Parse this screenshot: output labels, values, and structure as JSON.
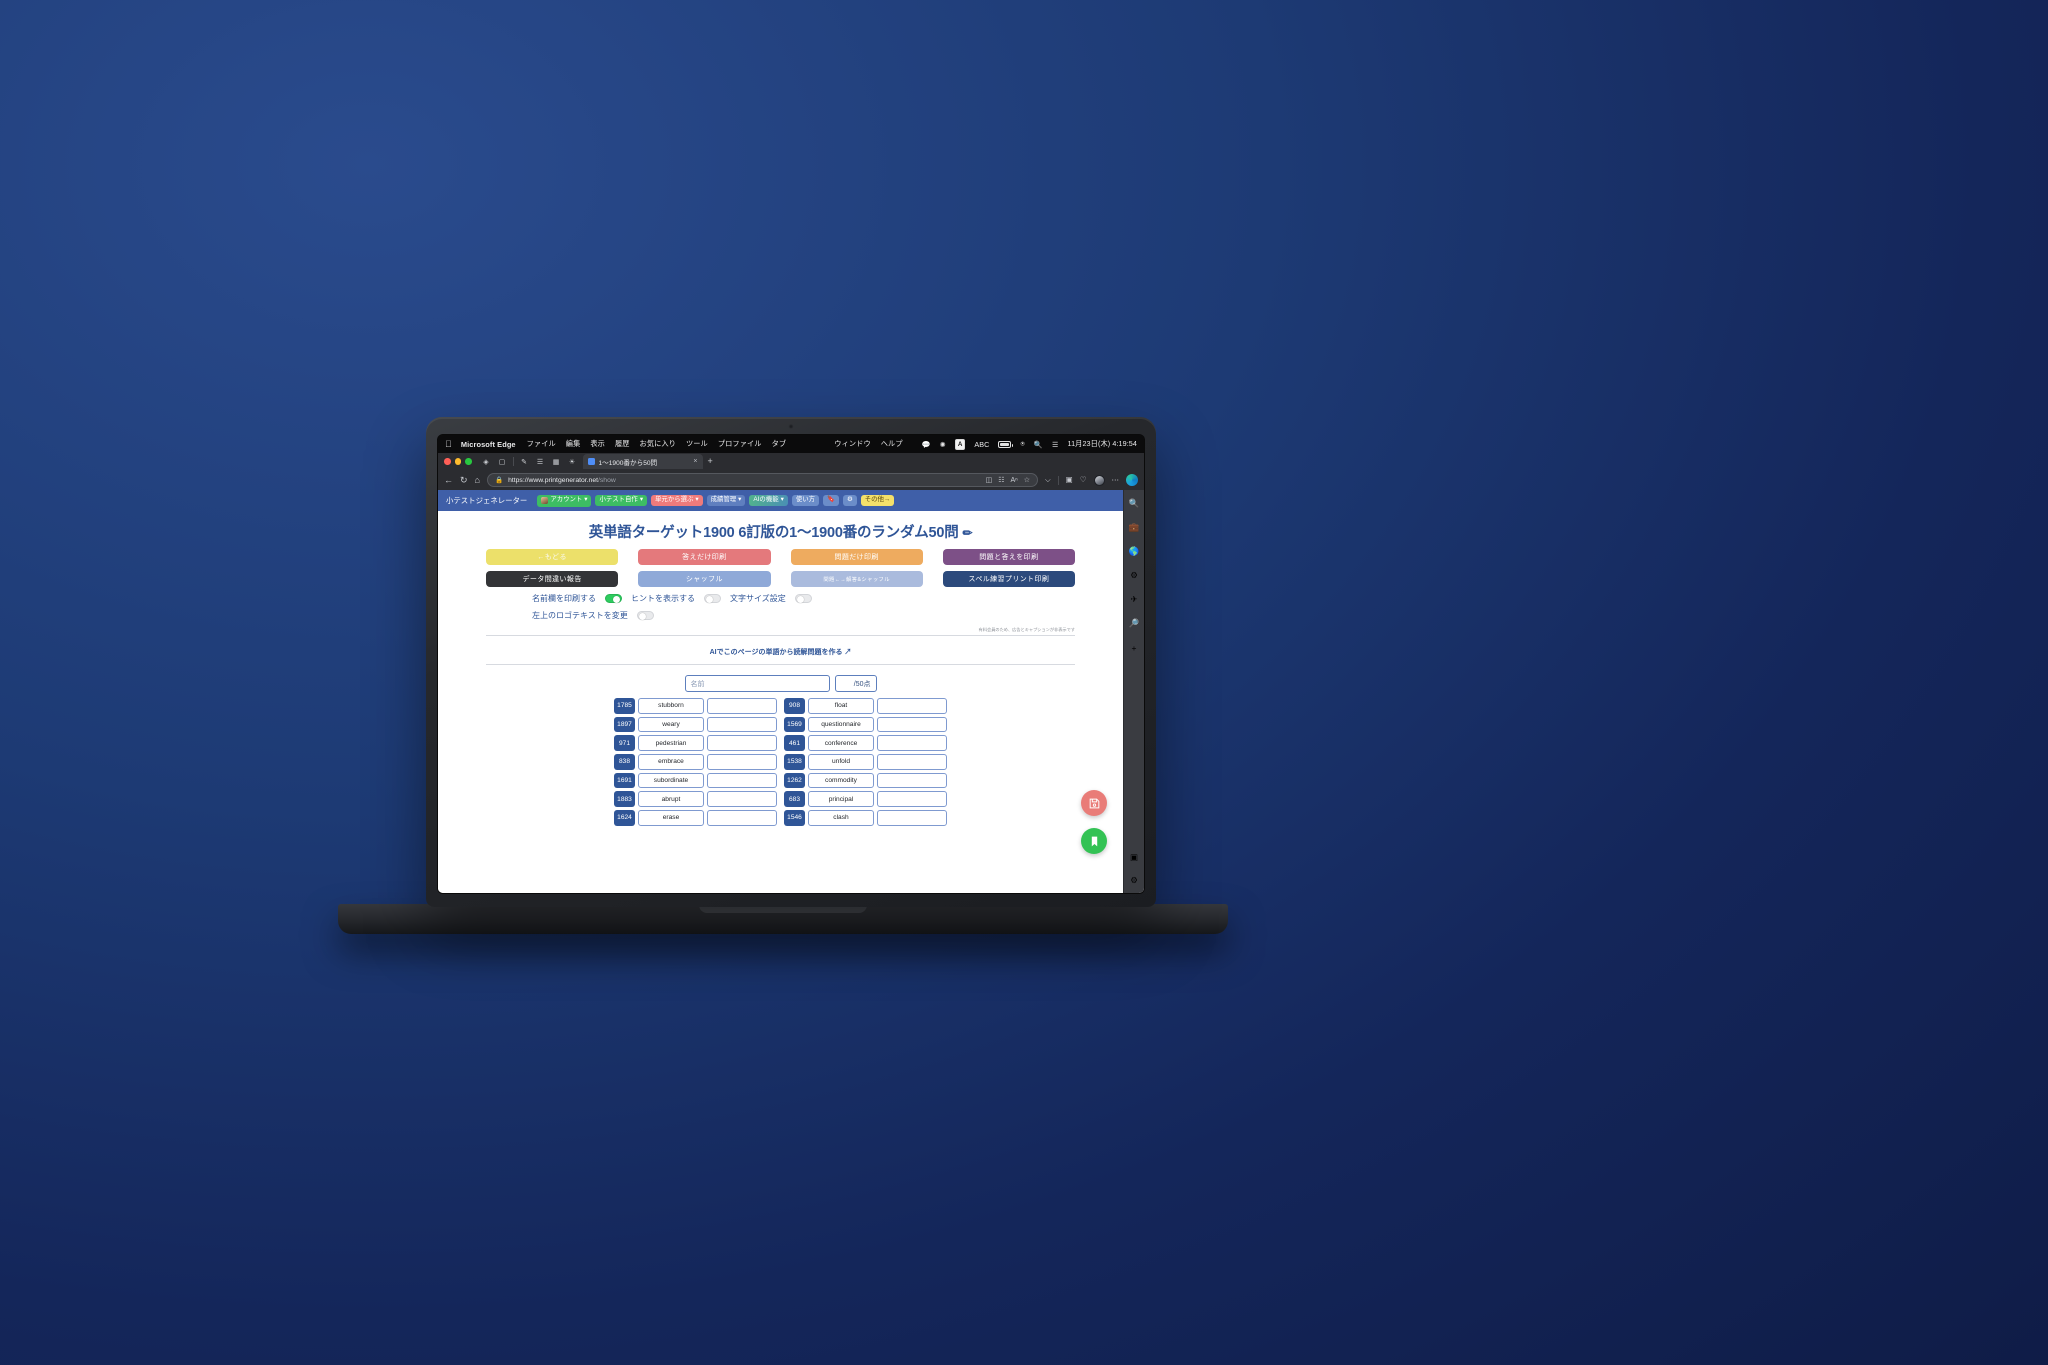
{
  "desktop": {
    "wallpaper_color": "#1d3a74"
  },
  "macos_menubar": {
    "apple_icon": "apple-icon",
    "app_name": "Microsoft Edge",
    "menus": [
      "ファイル",
      "編集",
      "表示",
      "履歴",
      "お気に入り",
      "ツール",
      "プロファイル",
      "タブ"
    ],
    "right_menus": [
      "ウィンドウ",
      "ヘルプ"
    ],
    "status_icons": [
      "chat-icon",
      "bluetooth-icon",
      "input-source-badge",
      "battery-icon",
      "wifi-icon",
      "search-icon",
      "control-center-icon"
    ],
    "input_source_label": "A",
    "input_source_text": "ABC",
    "datetime": "11月23日(木) 4:19:54"
  },
  "browser": {
    "tab": {
      "title": "1〜1900番から50問",
      "close_label": "×"
    },
    "new_tab_label": "+",
    "back_icon": "back-arrow-icon",
    "reload_icon": "reload-icon",
    "home_icon": "home-icon",
    "lock_icon": "lock-icon",
    "url_domain": "https://www.printgenerator.net",
    "url_path": "/show",
    "omnibox_icons": [
      "split-screen-icon",
      "qr-code-icon",
      "read-aloud-icon",
      "favorite-star-icon"
    ],
    "toolbar_icons": [
      "history-icon",
      "split-screen-icon",
      "collections-icon",
      "profile-avatar-icon",
      "more-options-icon",
      "copilot-icon"
    ],
    "sidebar_icons": [
      "search-icon",
      "tools-icon",
      "browser-essentials-icon",
      "settings-app-icon",
      "send-icon",
      "discover-icon",
      "add-icon"
    ],
    "sidebar_bottom_icons": [
      "sidebar-toggle-icon",
      "sidebar-settings-icon"
    ]
  },
  "site_nav": {
    "brand": "小テストジェネレーター",
    "items": [
      {
        "label": "アカウント",
        "caret": "▾",
        "color": "green",
        "icon": "account-avatar-icon"
      },
      {
        "label": "小テスト自作",
        "caret": "▾",
        "color": "green"
      },
      {
        "label": "単元から選ぶ",
        "caret": "▾",
        "color": "red"
      },
      {
        "label": "成績管理",
        "caret": "▾",
        "color": "blue"
      },
      {
        "label": "AIの機能",
        "caret": "▾",
        "color": "teal"
      },
      {
        "label": "使い方",
        "caret": "",
        "color": "lightblue"
      },
      {
        "label": "🔖",
        "caret": "",
        "color": "lightblue"
      },
      {
        "label": "⚙",
        "caret": "",
        "color": "lightblue"
      },
      {
        "label": "その他→",
        "caret": "",
        "color": "yellow"
      }
    ]
  },
  "page": {
    "title": "英単語ターゲット1900 6訂版の1〜1900番のランダム50問",
    "title_edit_icon": "pencil-icon",
    "buttons_row1": [
      {
        "label": "←もどる",
        "color": "yellow"
      },
      {
        "label": "答えだけ印刷",
        "color": "red"
      },
      {
        "label": "問題だけ印刷",
        "color": "orange"
      },
      {
        "label": "問題と答えを印刷",
        "color": "purple"
      }
    ],
    "buttons_row2": [
      {
        "label": "データ間違い報告",
        "color": "dark"
      },
      {
        "label": "シャッフル",
        "color": "blue"
      },
      {
        "label": "問題←→解答&シャッフル",
        "color": "palebluetiny"
      },
      {
        "label": "スペル練習プリント印刷",
        "color": "navy"
      }
    ],
    "toggles": [
      {
        "label": "名前欄を印刷する",
        "on": true
      },
      {
        "label": "ヒントを表示する",
        "on": false
      },
      {
        "label": "文字サイズ設定",
        "on": false
      },
      {
        "label": "左上のロゴテキストを変更",
        "on": false
      }
    ],
    "ad_note": "有料会員のため、広告とキャプションが非表示です",
    "ai_link": "AIでこのページの単語から読解問題を作る",
    "ai_link_icon": "external-link-icon",
    "name_placeholder": "名前",
    "score_label": "/50点",
    "fab_save_icon": "save-floppy-icon",
    "fab_bookmark_icon": "bookmark-icon",
    "quiz_left": [
      {
        "num": "1785",
        "word": "stubborn",
        "answer": ""
      },
      {
        "num": "1897",
        "word": "weary",
        "answer": ""
      },
      {
        "num": "971",
        "word": "pedestrian",
        "answer": ""
      },
      {
        "num": "838",
        "word": "embrace",
        "answer": ""
      },
      {
        "num": "1691",
        "word": "subordinate",
        "answer": ""
      },
      {
        "num": "1883",
        "word": "abrupt",
        "answer": ""
      },
      {
        "num": "1624",
        "word": "erase",
        "answer": ""
      }
    ],
    "quiz_right": [
      {
        "num": "908",
        "word": "float",
        "answer": ""
      },
      {
        "num": "1569",
        "word": "questionnaire",
        "answer": ""
      },
      {
        "num": "461",
        "word": "conference",
        "answer": ""
      },
      {
        "num": "1538",
        "word": "unfold",
        "answer": ""
      },
      {
        "num": "1262",
        "word": "commodity",
        "answer": ""
      },
      {
        "num": "683",
        "word": "principal",
        "answer": ""
      },
      {
        "num": "1546",
        "word": "clash",
        "answer": ""
      }
    ]
  }
}
